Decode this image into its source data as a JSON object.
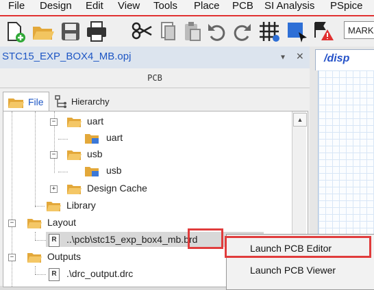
{
  "menu": [
    "File",
    "Design",
    "Edit",
    "View",
    "Tools",
    "Place",
    "PCB",
    "SI Analysis",
    "PSpice"
  ],
  "toolbar": {
    "icons": [
      "new-file-icon",
      "open-folder-icon",
      "save-icon",
      "print-icon",
      "cut-icon",
      "copy-icon",
      "paste-icon",
      "undo-icon",
      "redo-icon",
      "grid-icon",
      "select-box-icon",
      "drc-warning-icon"
    ],
    "mark_value": "MARK"
  },
  "project": {
    "title": "STC15_EXP_BOX4_MB.opj"
  },
  "doc_tab": {
    "label": "/disp"
  },
  "panel": {
    "title": "PCB",
    "tabs": {
      "file": "File",
      "hierarchy": "Hierarchy"
    }
  },
  "tree": {
    "uart_folder": "uart",
    "uart_child": "uart",
    "usb_folder": "usb",
    "usb_child": "usb",
    "design_cache": "Design Cache",
    "library": "Library",
    "layout": "Layout",
    "brd_file": "..\\pcb\\stc15_exp_box4_mb.brd",
    "outputs": "Outputs",
    "drc_file": ".\\drc_output.drc"
  },
  "context_menu": {
    "items": [
      "Launch PCB Editor",
      "Launch PCB Viewer"
    ]
  },
  "colors": {
    "accent_red": "#e03c3c",
    "link_blue": "#1d56c4",
    "folder_yellow": "#e8b94a"
  }
}
